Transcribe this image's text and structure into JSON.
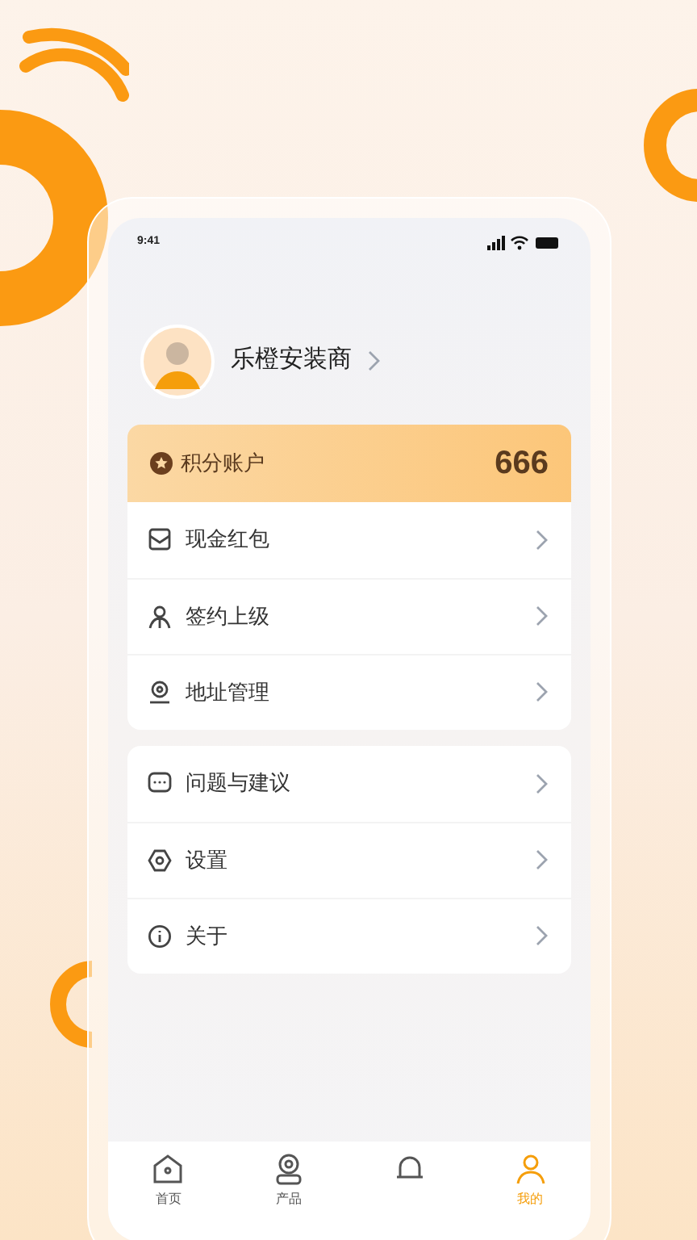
{
  "status_bar": {
    "time": "9:41"
  },
  "profile": {
    "name": "乐橙安装商"
  },
  "points": {
    "label": "积分账户",
    "value": "666"
  },
  "menu_groups": [
    [
      {
        "kind": "envelope",
        "label": "现金红包"
      },
      {
        "kind": "person",
        "label": "签约上级"
      },
      {
        "kind": "location",
        "label": "地址管理"
      }
    ],
    [
      {
        "kind": "chat",
        "label": "问题与建议"
      },
      {
        "kind": "gear",
        "label": "设置"
      },
      {
        "kind": "info",
        "label": "关于"
      }
    ]
  ],
  "tab_bar": [
    {
      "kind": "home",
      "label": "首页",
      "selected": false
    },
    {
      "kind": "camera",
      "label": "产品",
      "selected": false
    },
    {
      "kind": "bell",
      "selected": false
    },
    {
      "kind": "user",
      "label": "我的",
      "selected": true
    }
  ]
}
